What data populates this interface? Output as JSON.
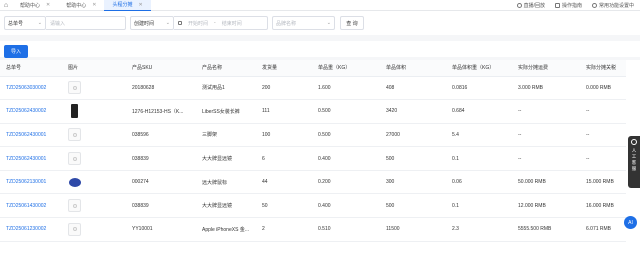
{
  "topbar": {
    "tabs": [
      {
        "label": "帮助中心",
        "active": false
      },
      {
        "label": "帮助中心",
        "active": false
      },
      {
        "label": "头程分摊",
        "active": true
      }
    ],
    "right_items": [
      {
        "icon": "play-icon",
        "label": "直播/回放"
      },
      {
        "icon": "guide-icon",
        "label": "操作指南"
      },
      {
        "icon": "user-icon",
        "label": "常用功能设置中"
      }
    ]
  },
  "filters": {
    "order_type": "总单号",
    "order_placeholder": "请输入",
    "time_type": "创建时间",
    "start_placeholder": "开始时间",
    "end_placeholder": "结束时间",
    "product_placeholder": "品牌名称",
    "query_label": "查 询"
  },
  "toolbar": {
    "import_label": "导入"
  },
  "table": {
    "columns": [
      "总单号",
      "图片",
      "产品SKU",
      "产品名称",
      "发货量",
      "单品重（KG）",
      "单品体积",
      "单品体积重（KG）",
      "实际分摊运费",
      "实际分摊关税"
    ],
    "rows": [
      {
        "order": "TZD25063030002",
        "pic": "placeholder",
        "sku": "20180628",
        "name": "测试用品1",
        "qty": "200",
        "weight": "1.600",
        "volume": "408",
        "vol_weight": "0.0816",
        "freight": "3.000 RMB",
        "duty": "0.000 RMB"
      },
      {
        "order": "TZD25062430002",
        "pic": "black",
        "sku": "1276-H12153-HS（K...",
        "name": "LiberSS女装长裤",
        "qty": "111",
        "weight": "0.500",
        "volume": "3420",
        "vol_weight": "0.684",
        "freight": "--",
        "duty": "--"
      },
      {
        "order": "TZD25062430001",
        "pic": "placeholder",
        "sku": "038596",
        "name": "三脚架",
        "qty": "100",
        "weight": "0.500",
        "volume": "27000",
        "vol_weight": "5.4",
        "freight": "--",
        "duty": "--"
      },
      {
        "order": "TZD25062430001",
        "pic": "placeholder",
        "sku": "038839",
        "name": "大大牌显远镜",
        "qty": "6",
        "weight": "0.400",
        "volume": "500",
        "vol_weight": "0.1",
        "freight": "--",
        "duty": "--"
      },
      {
        "order": "TZD25062130001",
        "pic": "mouse",
        "sku": "000274",
        "name": "远大牌鼠标",
        "qty": "44",
        "weight": "0.200",
        "volume": "300",
        "vol_weight": "0.06",
        "freight": "50.000 RMB",
        "duty": "15.000 RMB"
      },
      {
        "order": "TZD25061430002",
        "pic": "placeholder",
        "sku": "038839",
        "name": "大大牌显远镜",
        "qty": "50",
        "weight": "0.400",
        "volume": "500",
        "vol_weight": "0.1",
        "freight": "12.000 RMB",
        "duty": "16.000 RMB"
      },
      {
        "order": "TZD25061230002",
        "pic": "placeholder",
        "sku": "YY10001",
        "name": "Apple iPhoneXS 金...",
        "qty": "2",
        "weight": "0.510",
        "volume": "11500",
        "vol_weight": "2.3",
        "freight": "5555.500 RMB",
        "duty": "6.071 RMB"
      }
    ]
  },
  "float": {
    "label1": "人",
    "label2": "工",
    "label3": "客",
    "label4": "服",
    "ai": "AI"
  }
}
